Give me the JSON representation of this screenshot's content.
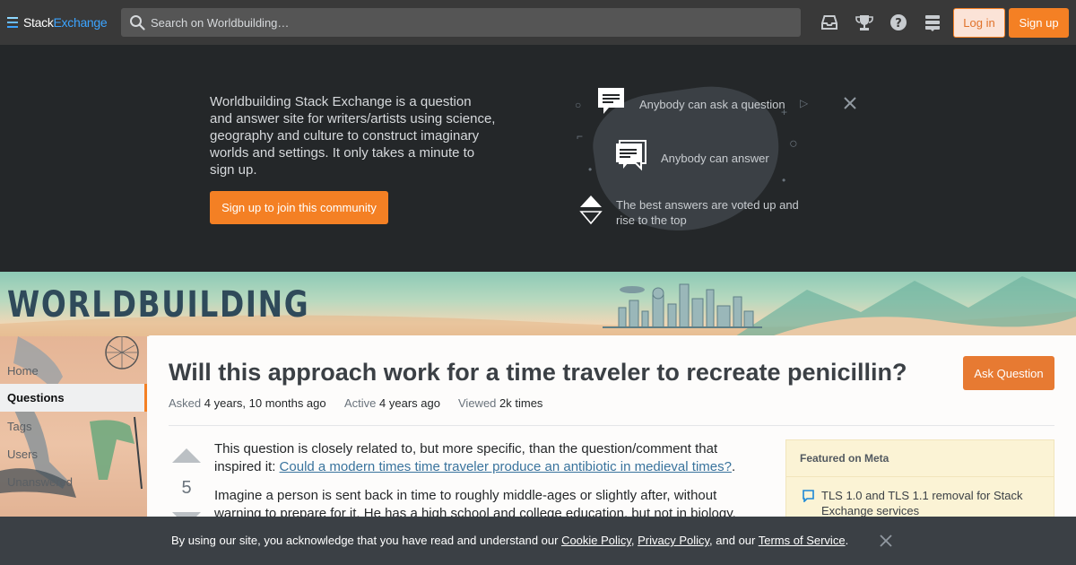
{
  "topbar": {
    "logo_part1": "Stack",
    "logo_part2": "Exchange",
    "search_placeholder": "Search on Worldbuilding…",
    "login_label": "Log in",
    "signup_label": "Sign up",
    "icons": [
      "inbox-icon",
      "achievements-icon",
      "help-icon",
      "site-switcher-icon"
    ]
  },
  "hero": {
    "description": "Worldbuilding Stack Exchange is a question and answer site for writers/artists using science, geography and culture to construct imaginary worlds and settings. It only takes a minute to sign up.",
    "join_button": "Sign up to join this community",
    "features": [
      "Anybody can ask a question",
      "Anybody can answer",
      "The best answers are voted up and rise to the top"
    ]
  },
  "banner": {
    "title": "WORLDBUILDING"
  },
  "leftnav": {
    "items": [
      "Home",
      "Questions",
      "Tags",
      "Users",
      "Unanswered"
    ],
    "active": "Questions"
  },
  "question": {
    "title": "Will this approach work for a time traveler to recreate penicillin?",
    "ask_button": "Ask Question",
    "asked_label": "Asked",
    "asked_value": "4 years, 10 months ago",
    "active_label": "Active",
    "active_value": "4 years ago",
    "viewed_label": "Viewed",
    "viewed_value": "2k times",
    "score": "5",
    "body_p1_before": "This question is closely related to, but more specific, than the question/comment that inspired it: ",
    "body_p1_link": "Could a modern times time traveler produce an antibiotic in medieval times?",
    "body_p1_after": ".",
    "body_p2": "Imagine a person is sent back in time to roughly middle-ages or slightly after, without warning to prepare for it. He has a high school and college education, but not in biology. Perhaps he a"
  },
  "sidebar": {
    "heading": "Featured on Meta",
    "item": "TLS 1.0 and TLS 1.1 removal for Stack Exchange services"
  },
  "cookie": {
    "text_before": "By using our site, you acknowledge that you have read and understand our ",
    "cookie_policy": "Cookie Policy",
    "sep1": ", ",
    "privacy_policy": "Privacy Policy",
    "sep2": ", and our ",
    "terms": "Terms of Service",
    "text_after": "."
  },
  "colors": {
    "topbar": "#393939",
    "hero_bg": "#242729",
    "accent": "#f48024",
    "link": "#39739d"
  }
}
